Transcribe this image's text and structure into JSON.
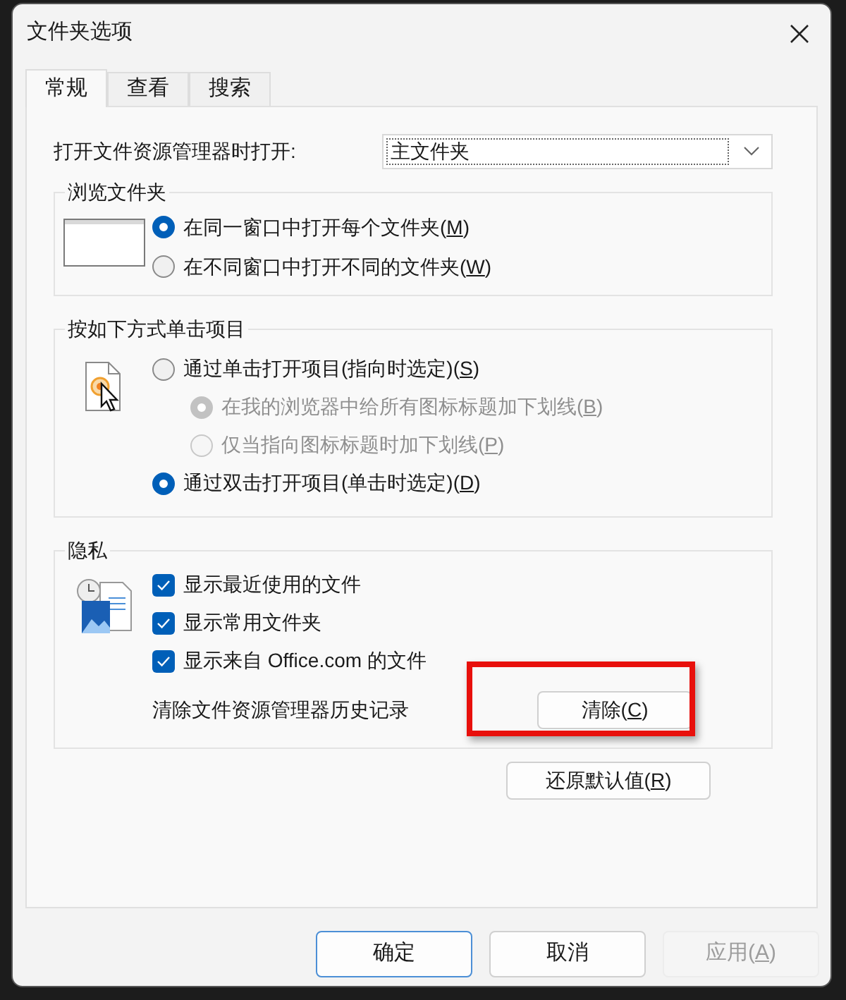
{
  "window": {
    "title": "文件夹选项"
  },
  "tabs": [
    {
      "label": "常规",
      "selected": true
    },
    {
      "label": "查看",
      "selected": false
    },
    {
      "label": "搜索",
      "selected": false
    }
  ],
  "open_explorer": {
    "label": "打开文件资源管理器时打开:",
    "value": "主文件夹"
  },
  "groups": [
    {
      "title": "浏览文件夹",
      "options": [
        {
          "kind": "radio",
          "label": "在同一窗口中打开每个文件夹(M)",
          "selected": true,
          "disabled": false
        },
        {
          "kind": "radio",
          "label": "在不同窗口中打开不同的文件夹(W)",
          "selected": false,
          "disabled": false
        }
      ]
    },
    {
      "title": "按如下方式单击项目",
      "options": [
        {
          "kind": "radio",
          "label": "通过单击打开项目(指向时选定)(S)",
          "selected": false,
          "disabled": false,
          "children": [
            {
              "kind": "radio",
              "label": "在我的浏览器中给所有图标标题加下划线(B)",
              "selected": true,
              "disabled": true
            },
            {
              "kind": "radio",
              "label": "仅当指向图标标题时加下划线(P)",
              "selected": false,
              "disabled": true
            }
          ]
        },
        {
          "kind": "radio",
          "label": "通过双击打开项目(单击时选定)(D)",
          "selected": true,
          "disabled": false
        }
      ]
    },
    {
      "title": "隐私",
      "options": [
        {
          "kind": "checkbox",
          "label": "显示最近使用的文件",
          "checked": true
        },
        {
          "kind": "checkbox",
          "label": "显示常用文件夹",
          "checked": true
        },
        {
          "kind": "checkbox",
          "label": "显示来自 Office.com 的文件",
          "checked": true
        },
        {
          "kind": "action",
          "label": "清除文件资源管理器历史记录",
          "button": "清除(C)",
          "highlighted": true
        }
      ]
    }
  ],
  "restore_button": "还原默认值(R)",
  "footer_buttons": [
    {
      "label": "确定",
      "default": true,
      "disabled": false,
      "access_key": false
    },
    {
      "label": "取消",
      "default": false,
      "disabled": false,
      "access_key": false
    },
    {
      "label": "应用(A)",
      "default": false,
      "disabled": true,
      "access_key": true
    }
  ]
}
